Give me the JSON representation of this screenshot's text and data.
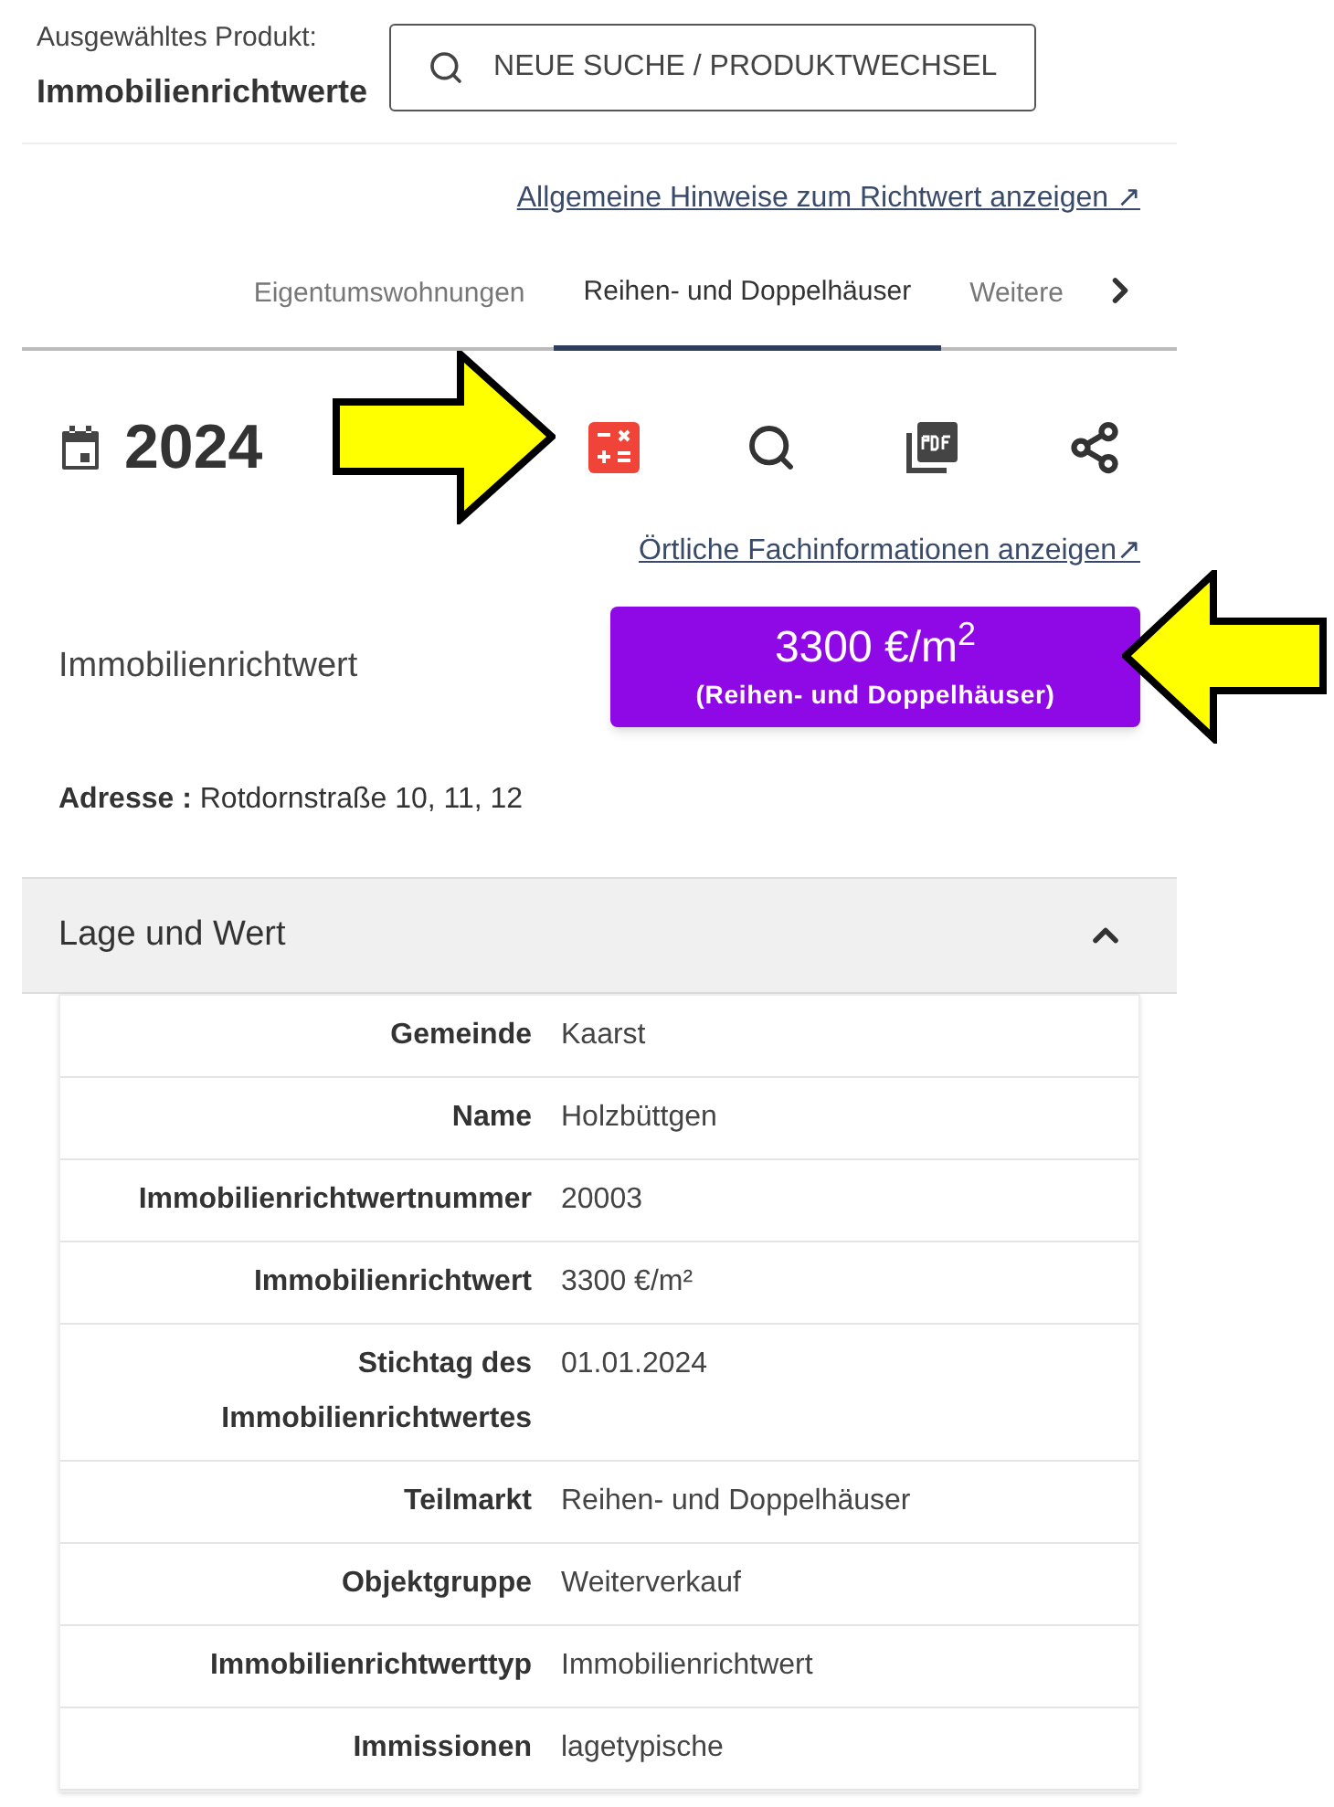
{
  "product": {
    "label": "Ausgewähltes Produkt:",
    "name": "Immobilienrichtwerte",
    "search_button": "NEUE SUCHE / PRODUKTWECHSEL"
  },
  "general_link": "Allgemeine Hinweise zum Richtwert anzeigen ↗",
  "tabs": [
    {
      "label": "Eigentumswohnungen",
      "selected": false
    },
    {
      "label": "Reihen- und Doppelhäuser",
      "selected": true
    },
    {
      "label": "Weitere",
      "selected": false
    }
  ],
  "year": "2024",
  "local_link": "Örtliche Fachinformationen anzeigen↗",
  "value_label": "Immobilienrichtwert",
  "value_badge": {
    "value": "3300 €/m$^{2}$",
    "subtitle": "(Reihen- und Doppelhäuser)"
  },
  "address": {
    "label": "Adresse :",
    "value": "Rotdornstraße 10, 11, 12"
  },
  "section": {
    "title": "Lage und Wert",
    "expanded": true,
    "rows": [
      {
        "label": "Gemeinde",
        "value": "Kaarst"
      },
      {
        "label": "Name",
        "value": "Holzbüttgen"
      },
      {
        "label": "Immobilienrichtwertnummer",
        "value": "20003"
      },
      {
        "label": "Immobilienrichtwert",
        "value": "3300 €/m²"
      },
      {
        "label": "Stichtag des Immobilienrichtwertes",
        "value": "01.01.2024"
      },
      {
        "label": "Teilmarkt",
        "value": "Reihen- und Doppelhäuser"
      },
      {
        "label": "Objektgruppe",
        "value": "Weiterverkauf"
      },
      {
        "label": "Immobilienrichtwerttyp",
        "value": "Immobilienrichtwert"
      },
      {
        "label": "Immissionen",
        "value": "lagetypische"
      }
    ]
  }
}
